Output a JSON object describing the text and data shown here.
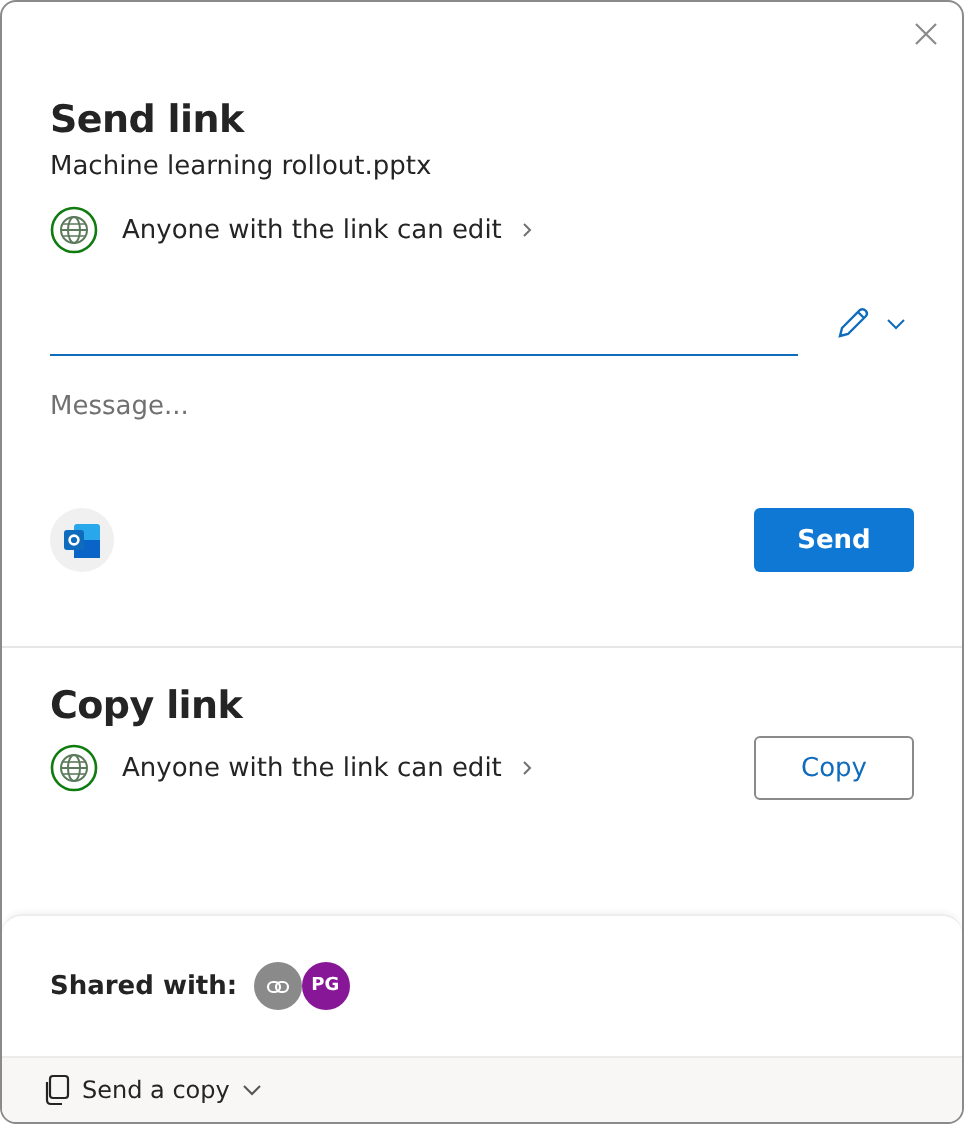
{
  "send_link": {
    "title": "Send link",
    "file_name": "Machine learning rollout.pptx",
    "permission": "Anyone with the link can edit",
    "message": {
      "placeholder": "Message..."
    },
    "button": "Send"
  },
  "copy_link": {
    "title": "Copy link",
    "permission": "Anyone with the link can edit",
    "button": "Copy"
  },
  "shared_with": {
    "label": "Shared with:",
    "people": [
      {
        "kind": "link",
        "color": "#8a8a8a"
      },
      {
        "kind": "initials",
        "initials": "PG",
        "color": "#881798"
      }
    ]
  },
  "footer": {
    "action": "Send a copy"
  }
}
